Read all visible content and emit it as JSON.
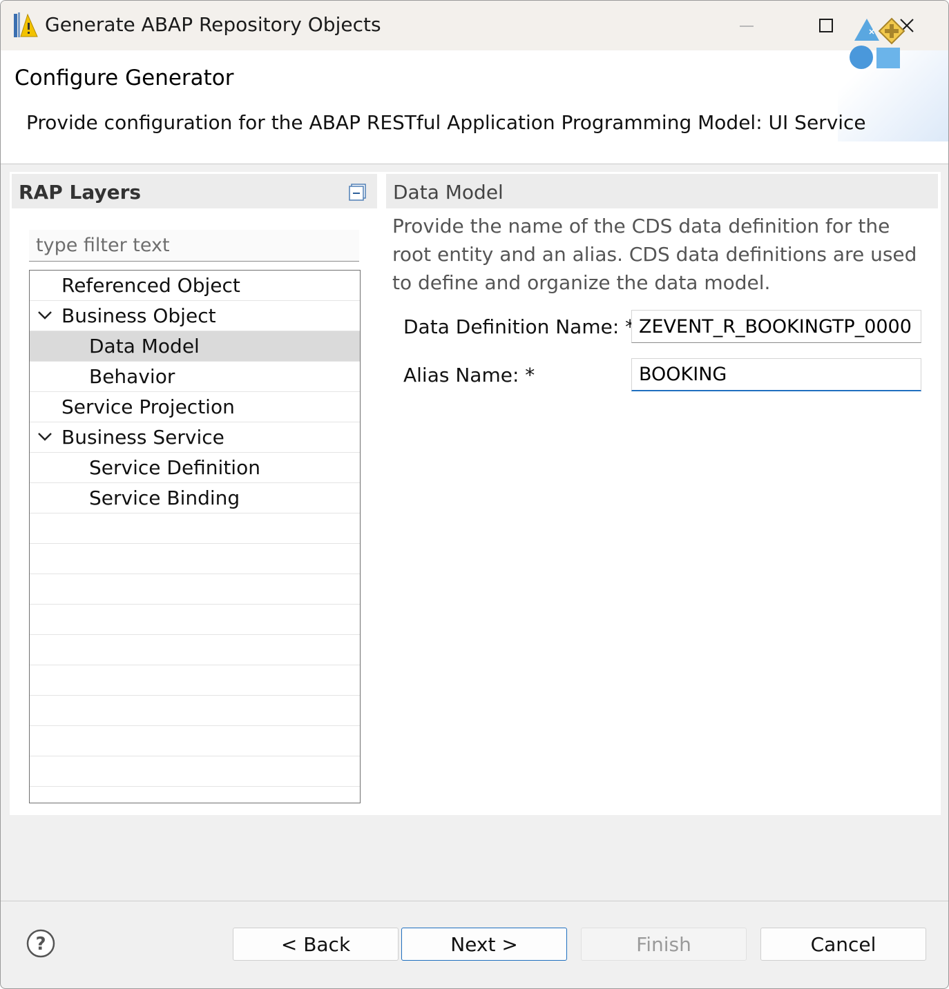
{
  "window": {
    "title": "Generate ABAP Repository Objects",
    "controls": {
      "minimize": "minimize-icon",
      "maximize": "maximize-icon",
      "close": "close-icon"
    }
  },
  "banner": {
    "title": "Configure Generator",
    "message": "Provide configuration for the ABAP RESTful Application Programming Model: UI Service",
    "icon": "wizard-shapes-icon"
  },
  "left_panel": {
    "title": "RAP Layers",
    "collapse_icon": "collapse-all-icon",
    "filter": {
      "placeholder": "type filter text",
      "value": ""
    },
    "tree": [
      {
        "label": "Referenced Object",
        "level": 0,
        "expanded": null,
        "selected": false
      },
      {
        "label": "Business Object",
        "level": 0,
        "expanded": true,
        "selected": false
      },
      {
        "label": "Data Model",
        "level": 1,
        "expanded": null,
        "selected": true
      },
      {
        "label": "Behavior",
        "level": 1,
        "expanded": null,
        "selected": false
      },
      {
        "label": "Service Projection",
        "level": 0,
        "expanded": null,
        "selected": false
      },
      {
        "label": "Business Service",
        "level": 0,
        "expanded": true,
        "selected": false
      },
      {
        "label": "Service Definition",
        "level": 1,
        "expanded": null,
        "selected": false
      },
      {
        "label": "Service Binding",
        "level": 1,
        "expanded": null,
        "selected": false
      }
    ]
  },
  "right_panel": {
    "title": "Data Model",
    "description": "Provide the name of the CDS data definition for the root entity and an alias. CDS data definitions are used to define and organize the data model.",
    "fields": {
      "data_definition": {
        "label": "Data Definition Name: *",
        "value": "ZEVENT_R_BOOKINGTP_0000"
      },
      "alias": {
        "label": "Alias Name: *",
        "value": "BOOKING"
      }
    }
  },
  "footer": {
    "help_icon": "help-icon",
    "back": "< Back",
    "next": "Next >",
    "finish": "Finish",
    "cancel": "Cancel"
  },
  "colors": {
    "accent": "#1f6fbf",
    "selected_row": "#dadada",
    "header_bg": "#ececec"
  }
}
